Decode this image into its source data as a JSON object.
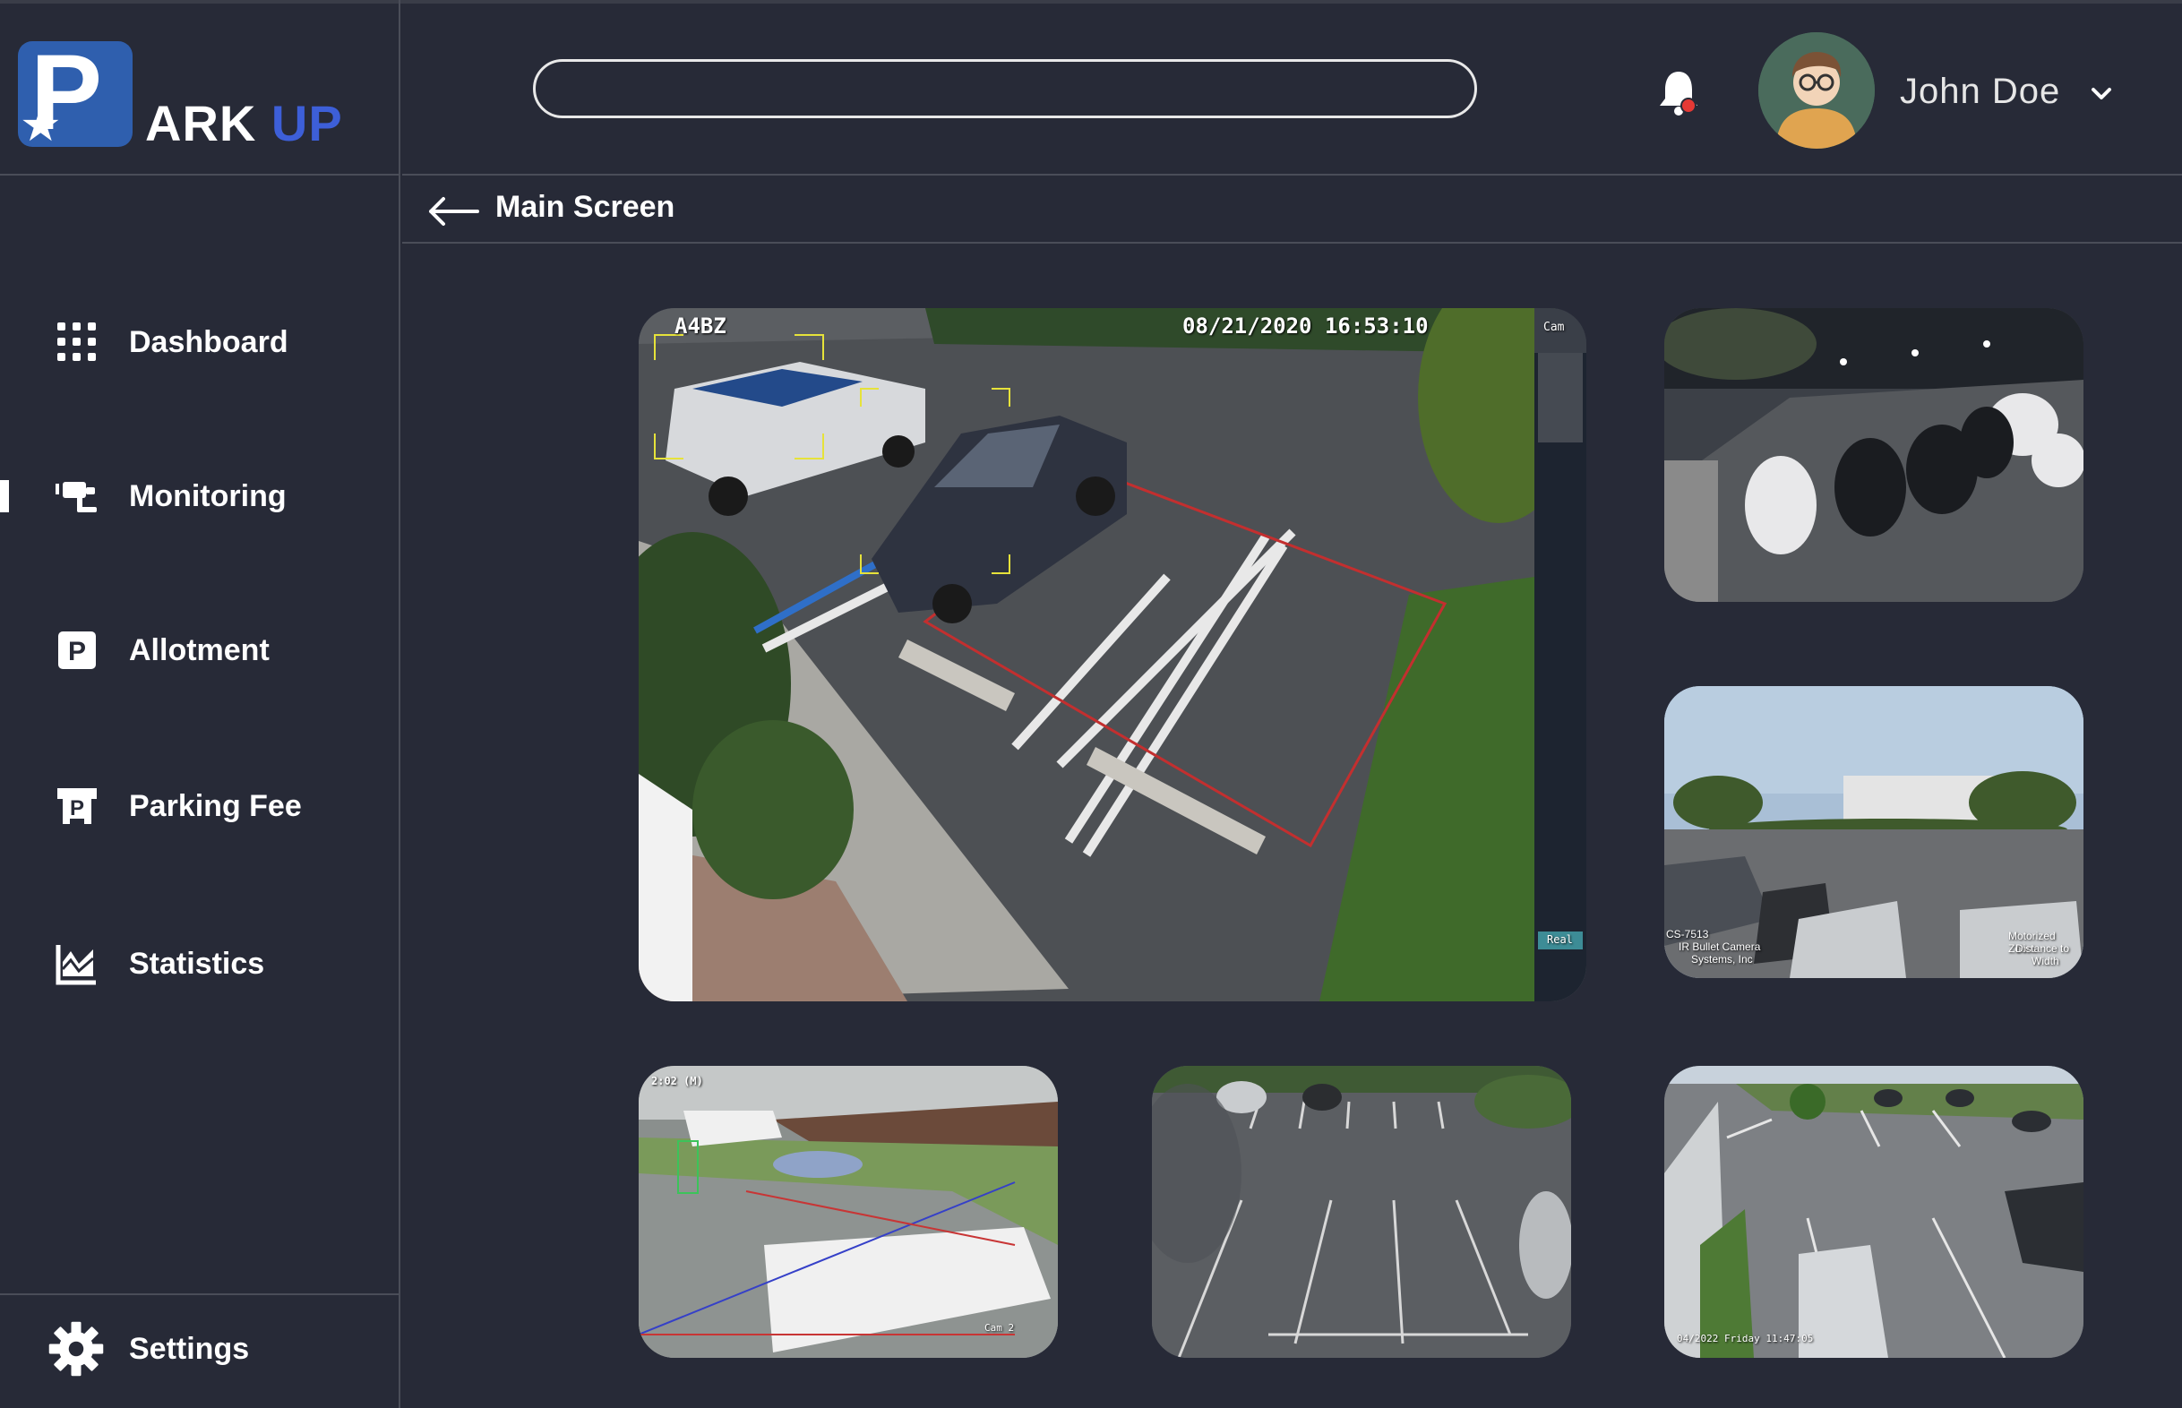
{
  "brand": {
    "logo_letter": "P",
    "name_part1": "ARK",
    "name_part2": "UP",
    "primary_color": "#2f5fae",
    "accent_color": "#3d5fd8"
  },
  "sidebar": {
    "items": [
      {
        "label": "Dashboard",
        "icon": "grid-icon"
      },
      {
        "label": "Monitoring",
        "icon": "cctv-camera-icon",
        "active": true
      },
      {
        "label": "Allotment",
        "icon": "parking-sign-icon"
      },
      {
        "label": "Parking Fee",
        "icon": "parking-ticket-icon"
      },
      {
        "label": "Statistics",
        "icon": "chart-area-icon"
      }
    ],
    "settings_label": "Settings"
  },
  "header": {
    "search_placeholder": "",
    "user_name": "John Doe",
    "notification_dot_color": "#e53935"
  },
  "breadcrumb": {
    "title": "Main Screen"
  },
  "cameras": {
    "main": {
      "id_label": "A4BZ",
      "timestamp": "08/21/2020  16:53:10",
      "side_text_1": "Cam",
      "side_text_2": "Real"
    },
    "cam2": {},
    "cam3": {
      "overlay_1": "CS-7513",
      "overlay_2": "IR Bullet Camera",
      "overlay_3": "Systems, Inc",
      "overlay_4": "Motorized Zoom",
      "overlay_5": "Distance to",
      "overlay_6": "Width"
    },
    "cam4": {
      "timestamp": "2:02 (M)",
      "cam_label": "Cam 2"
    },
    "cam5": {},
    "cam6": {
      "timestamp": "04/2022 Friday 11:47:05"
    }
  }
}
